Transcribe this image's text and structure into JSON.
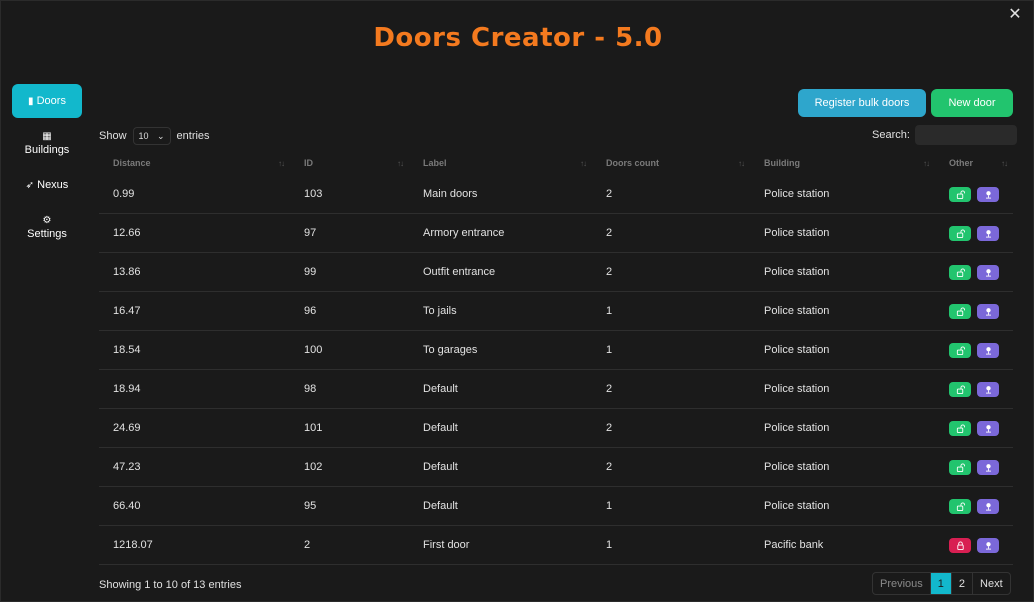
{
  "app": {
    "title": "Doors Creator - 5.0"
  },
  "sidebar": {
    "items": [
      {
        "label": "Doors",
        "icon": "door-icon",
        "active": true
      },
      {
        "label": "Buildings",
        "icon": "building-icon"
      },
      {
        "label": "Nexus",
        "icon": "rocket-icon"
      },
      {
        "label": "Settings",
        "icon": "gear-icon"
      }
    ]
  },
  "toolbar": {
    "bulk_label": "Register bulk doors",
    "new_label": "New door"
  },
  "controls": {
    "show_label": "Show",
    "show_value": "10",
    "entries_label": "entries",
    "search_label": "Search:",
    "search_value": ""
  },
  "table": {
    "columns": [
      "Distance",
      "ID",
      "Label",
      "Doors count",
      "Building",
      "Other"
    ],
    "rows": [
      {
        "distance": "0.99",
        "id": "103",
        "label": "Main doors",
        "count": "2",
        "building": "Police station",
        "locked": false
      },
      {
        "distance": "12.66",
        "id": "97",
        "label": "Armory entrance",
        "count": "2",
        "building": "Police station",
        "locked": false
      },
      {
        "distance": "13.86",
        "id": "99",
        "label": "Outfit entrance",
        "count": "2",
        "building": "Police station",
        "locked": false
      },
      {
        "distance": "16.47",
        "id": "96",
        "label": "To jails",
        "count": "1",
        "building": "Police station",
        "locked": false
      },
      {
        "distance": "18.54",
        "id": "100",
        "label": "To garages",
        "count": "1",
        "building": "Police station",
        "locked": false
      },
      {
        "distance": "18.94",
        "id": "98",
        "label": "Default",
        "count": "2",
        "building": "Police station",
        "locked": false
      },
      {
        "distance": "24.69",
        "id": "101",
        "label": "Default",
        "count": "2",
        "building": "Police station",
        "locked": false
      },
      {
        "distance": "47.23",
        "id": "102",
        "label": "Default",
        "count": "2",
        "building": "Police station",
        "locked": false
      },
      {
        "distance": "66.40",
        "id": "95",
        "label": "Default",
        "count": "1",
        "building": "Police station",
        "locked": false
      },
      {
        "distance": "1218.07",
        "id": "2",
        "label": "First door",
        "count": "1",
        "building": "Pacific bank",
        "locked": true
      }
    ]
  },
  "footer": {
    "info": "Showing 1 to 10 of 13 entries",
    "pager": {
      "previous": "Previous",
      "pages": [
        "1",
        "2"
      ],
      "current": "1",
      "next": "Next"
    }
  },
  "colors": {
    "title": "#f47a1f",
    "accent": "#12b8cc",
    "success": "#22c46e",
    "danger": "#d81f52",
    "purple": "#7b68d9",
    "info": "#2ea6cc"
  }
}
